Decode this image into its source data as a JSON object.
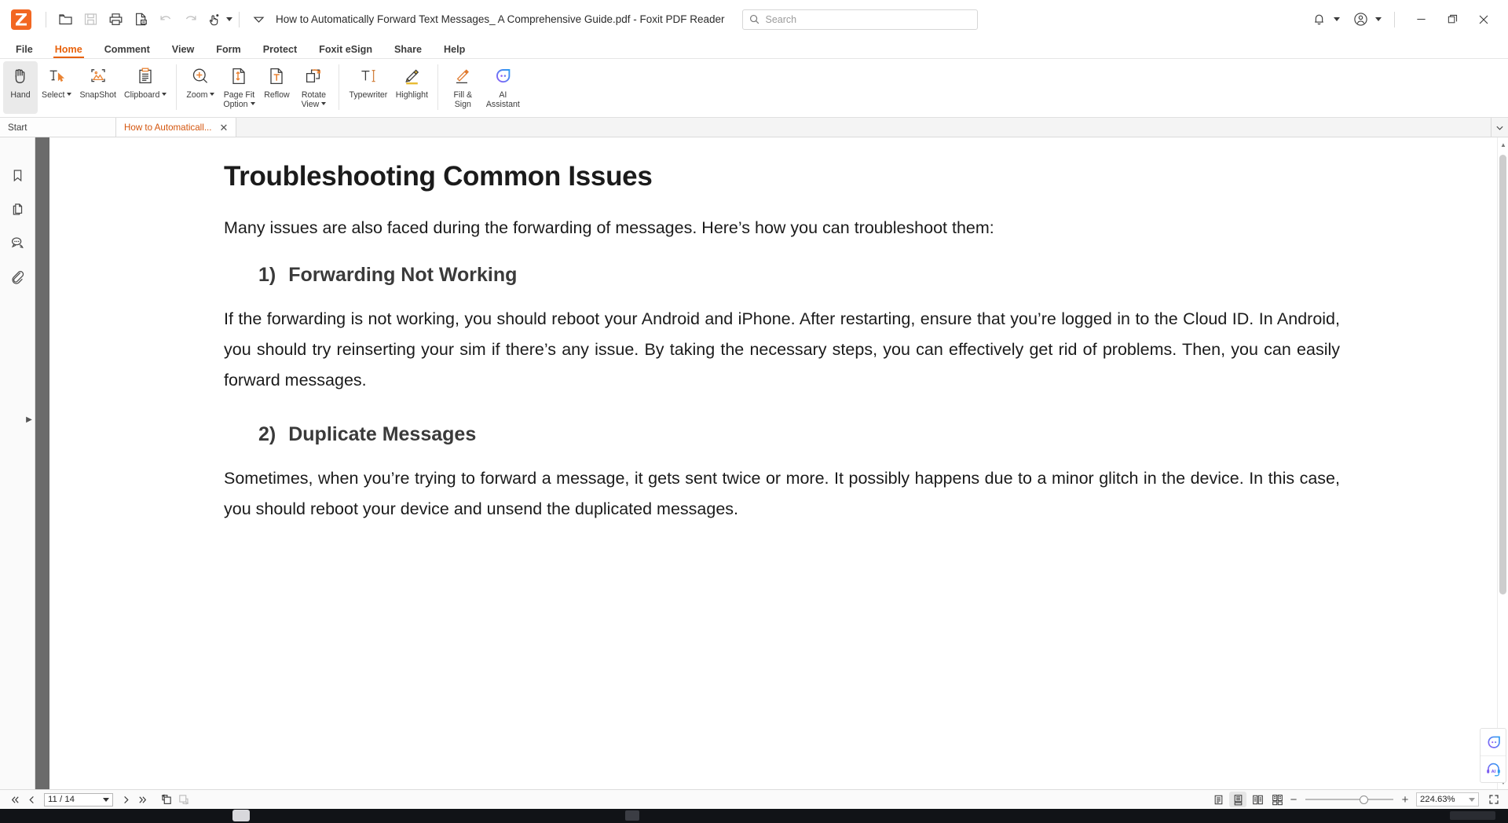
{
  "window": {
    "document_title": "How to Automatically Forward Text Messages_ A Comprehensive Guide.pdf - Foxit PDF Reader",
    "app_name": "Foxit PDF Reader"
  },
  "titlebar": {
    "icons": [
      "foxit-logo",
      "open-icon",
      "save-icon",
      "print-icon",
      "create-pdf-icon",
      "undo-icon",
      "redo-icon",
      "touch-mode-icon",
      "customize-toolbar-icon"
    ],
    "notification_label": "notification-bell",
    "account_label": "account",
    "minimize_label": "minimize",
    "restore_label": "restore",
    "close_label": "close"
  },
  "search": {
    "placeholder": "Search",
    "value": ""
  },
  "menu": {
    "items": [
      {
        "label": "File",
        "active": false
      },
      {
        "label": "Home",
        "active": true
      },
      {
        "label": "Comment",
        "active": false
      },
      {
        "label": "View",
        "active": false
      },
      {
        "label": "Form",
        "active": false
      },
      {
        "label": "Protect",
        "active": false
      },
      {
        "label": "Foxit eSign",
        "active": false
      },
      {
        "label": "Share",
        "active": false
      },
      {
        "label": "Help",
        "active": false
      }
    ],
    "accent_color": "#e8620c"
  },
  "ribbon": {
    "groups": [
      {
        "tools": [
          {
            "label": "Hand",
            "icon": "hand-icon",
            "selected": true,
            "dropdown": false
          },
          {
            "label": "Select",
            "icon": "select-text-icon",
            "selected": false,
            "dropdown": true
          },
          {
            "label": "SnapShot",
            "icon": "snapshot-icon",
            "selected": false,
            "dropdown": false
          },
          {
            "label": "Clipboard",
            "icon": "clipboard-icon",
            "selected": false,
            "dropdown": true
          }
        ]
      },
      {
        "tools": [
          {
            "label": "Zoom",
            "icon": "zoom-in-icon",
            "selected": false,
            "dropdown": true
          },
          {
            "label": "Page Fit\nOption",
            "icon": "page-fit-icon",
            "selected": false,
            "dropdown": true
          },
          {
            "label": "Reflow",
            "icon": "reflow-icon",
            "selected": false,
            "dropdown": false
          },
          {
            "label": "Rotate\nView",
            "icon": "rotate-view-icon",
            "selected": false,
            "dropdown": true
          }
        ]
      },
      {
        "tools": [
          {
            "label": "Typewriter",
            "icon": "typewriter-icon",
            "selected": false,
            "dropdown": false
          },
          {
            "label": "Highlight",
            "icon": "highlight-icon",
            "selected": false,
            "dropdown": false
          }
        ]
      },
      {
        "tools": [
          {
            "label": "Fill &\nSign",
            "icon": "fill-sign-icon",
            "selected": false,
            "dropdown": false
          },
          {
            "label": "AI\nAssistant",
            "icon": "ai-assistant-icon",
            "selected": false,
            "dropdown": false
          }
        ]
      }
    ]
  },
  "doc_tabs": [
    {
      "label": "Start",
      "active": false,
      "closable": false
    },
    {
      "label": "How to Automaticall...",
      "active": true,
      "closable": true
    }
  ],
  "left_rail": {
    "items": [
      {
        "name": "bookmarks-panel",
        "icon": "bookmark-icon"
      },
      {
        "name": "pages-panel",
        "icon": "pages-icon"
      },
      {
        "name": "comments-panel",
        "icon": "comment-icon"
      },
      {
        "name": "attachments-panel",
        "icon": "attachment-icon"
      }
    ],
    "expander": "▶"
  },
  "pdf": {
    "heading": "Troubleshooting Common Issues",
    "intro": "Many issues are also faced during the forwarding of messages. Here’s how you can troubleshoot them:",
    "sections": [
      {
        "number": "1)",
        "title": "Forwarding Not Working",
        "body": "If the forwarding is not working, you should reboot your Android and iPhone. After restarting, ensure that you’re logged in to the Cloud ID. In Android, you should try reinserting your sim if there’s any issue. By taking the necessary steps, you can effectively get rid of problems. Then, you can easily forward messages."
      },
      {
        "number": "2)",
        "title": "Duplicate Messages",
        "body": "Sometimes, when you’re trying to forward a message, it gets sent twice or more. It possibly happens due to a minor glitch in the device. In this case, you should reboot your device and unsend the duplicated messages."
      }
    ]
  },
  "floating": {
    "ai_chat": "ai-chat-bubble-icon",
    "ai_voice": "ai-headset-icon"
  },
  "statusbar": {
    "first_page": "first-page-icon",
    "prev_page": "previous-page-icon",
    "page_value": "11 / 14",
    "current_page": 11,
    "total_pages": 14,
    "next_page": "next-page-icon",
    "last_page": "last-page-icon",
    "rotate_left": "rotate-left-icon",
    "rotate_right": "rotate-right-icon",
    "view_modes": [
      {
        "name": "single-page-view",
        "selected": false
      },
      {
        "name": "continuous-scroll-view",
        "selected": true
      },
      {
        "name": "facing-view",
        "selected": false
      },
      {
        "name": "continuous-facing-view",
        "selected": false
      }
    ],
    "zoom_out": "−",
    "zoom_in": "+",
    "zoom_value": "224.63%",
    "zoom_percent": 224.63,
    "fullscreen": "fullscreen-icon"
  },
  "colors": {
    "accent": "#e8620c",
    "brand_orange": "#f26722",
    "ai_purple": "#8b5cf6",
    "ai_blue": "#2b9cf0",
    "highlight_yellow": "#e8bb33",
    "text": "#1b1b1b",
    "heading_gray": "#3a3a3a"
  }
}
